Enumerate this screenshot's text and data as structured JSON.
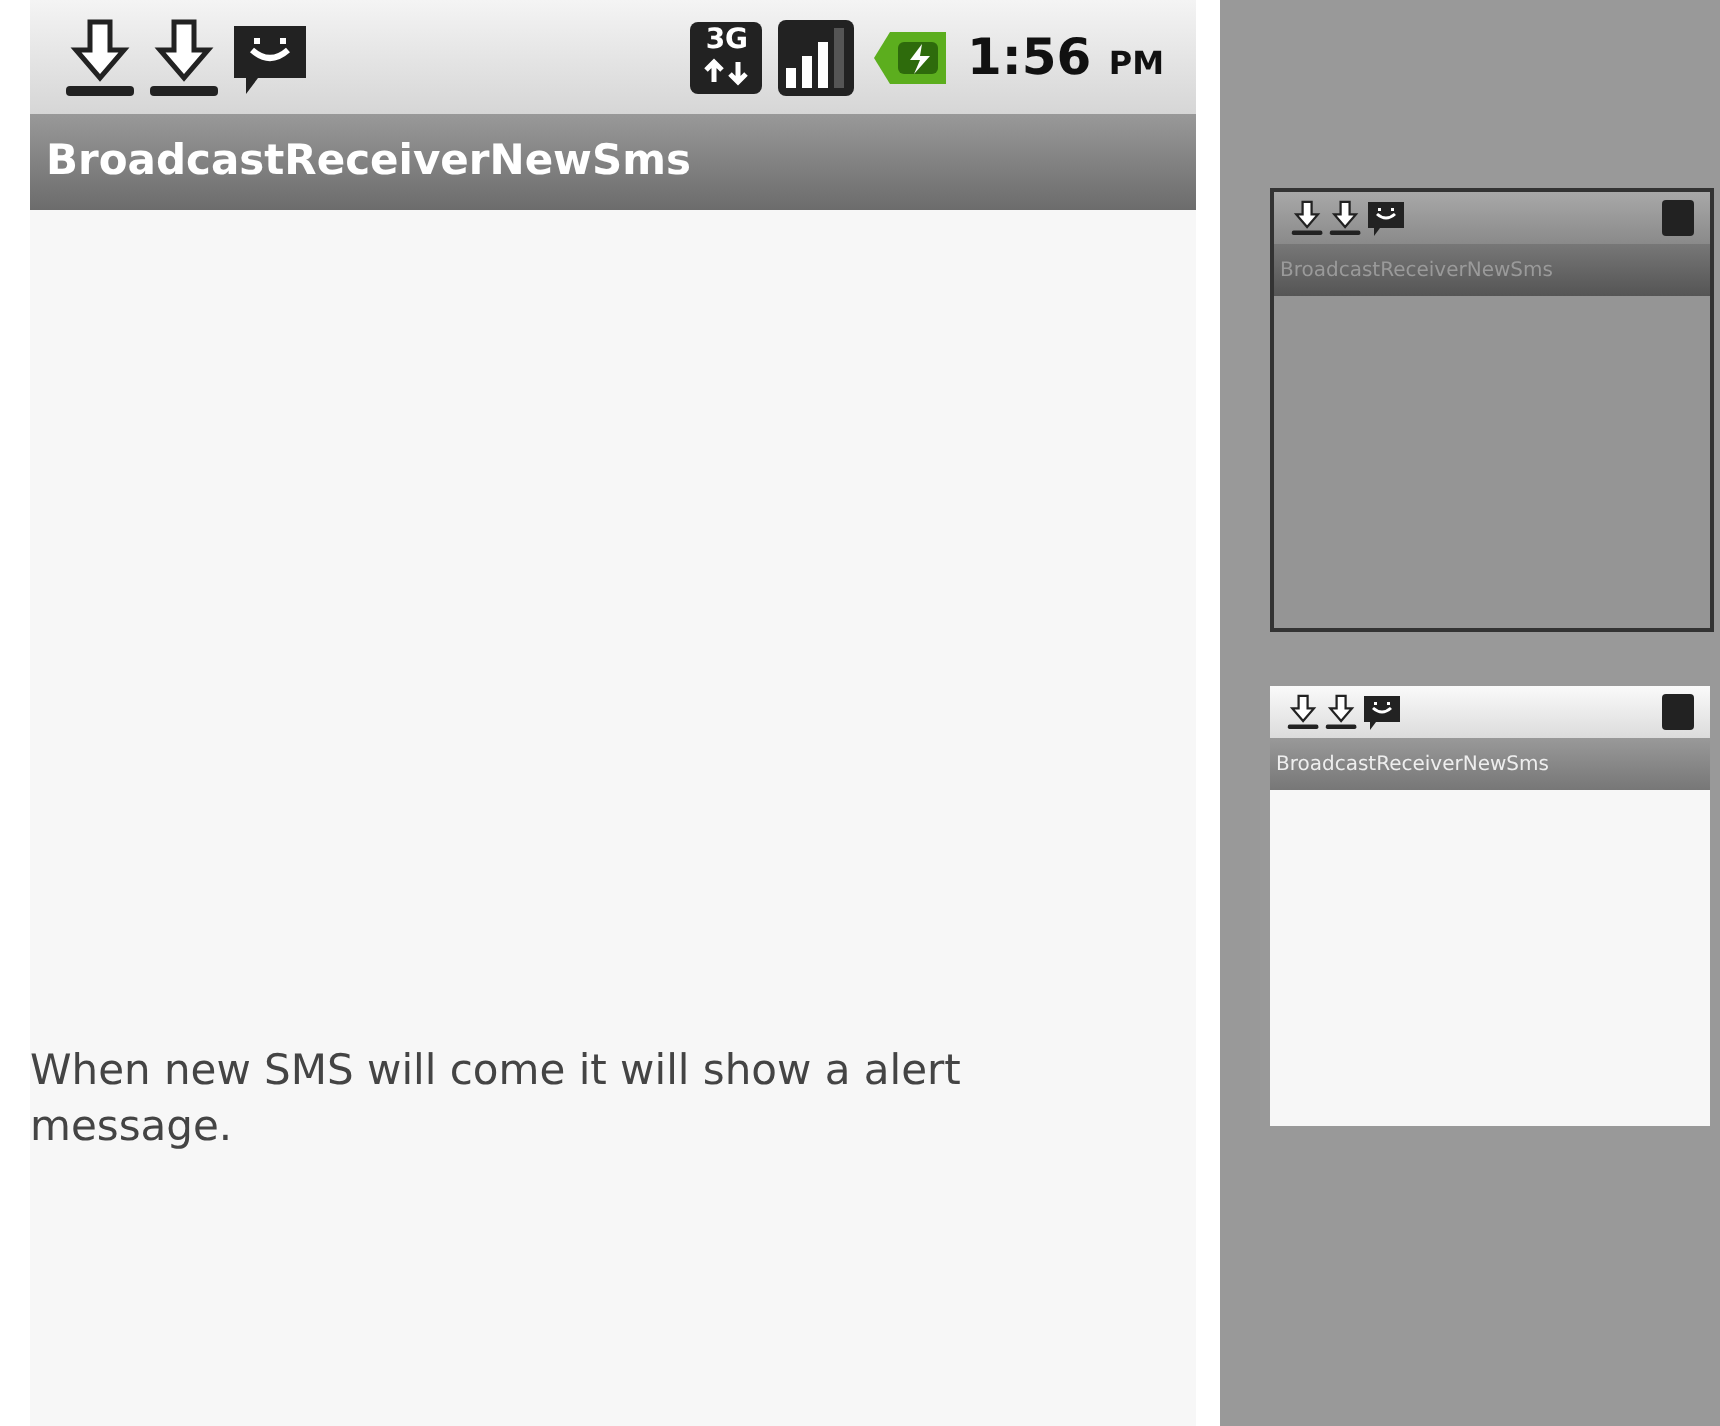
{
  "status_bar": {
    "network_type": "3G",
    "time": "1:56",
    "meridiem": "PM"
  },
  "app_bar": {
    "title": "BroadcastReceiverNewSms"
  },
  "content": {
    "message": "When new SMS will come it will show a alert message."
  },
  "previews": [
    {
      "title": "BroadcastReceiverNewSms",
      "dimmed": true
    },
    {
      "title": "BroadcastReceiverNewSms",
      "dimmed": false
    }
  ]
}
